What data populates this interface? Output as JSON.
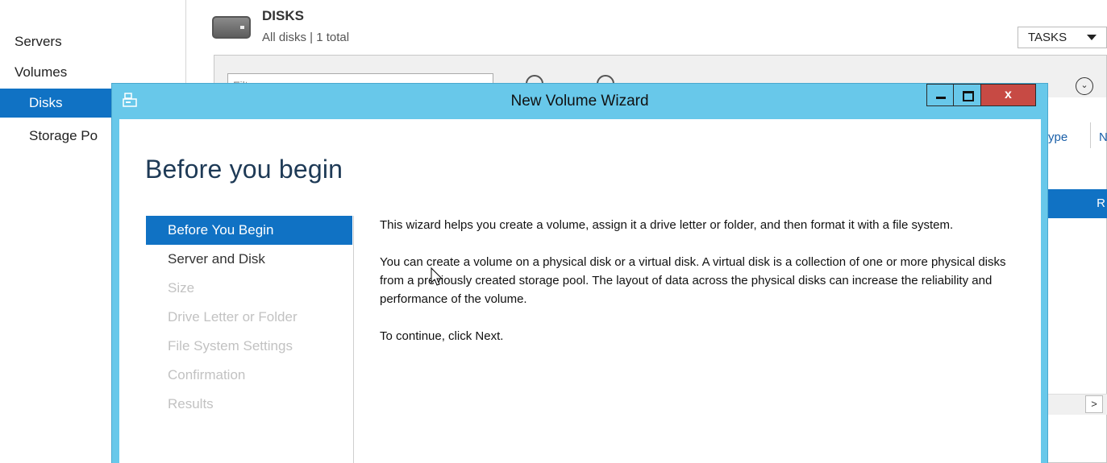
{
  "nav": {
    "items": [
      {
        "label": "Servers"
      },
      {
        "label": "Volumes"
      },
      {
        "label": "Disks"
      },
      {
        "label": "Storage Po"
      }
    ]
  },
  "disks": {
    "title": "DISKS",
    "subtitle": "All disks | 1 total",
    "tasks_label": "TASKS",
    "filter_placeholder": "Filter",
    "col_type": "ype",
    "col_n": "N",
    "selected_row_text": "R",
    "scroll_right": ">",
    "expand_glyph": "⌄"
  },
  "wizard": {
    "title": "New Volume Wizard",
    "close_label": "x",
    "page_title": "Before you begin",
    "steps": [
      {
        "label": "Before You Begin"
      },
      {
        "label": "Server and Disk"
      },
      {
        "label": "Size"
      },
      {
        "label": "Drive Letter or Folder"
      },
      {
        "label": "File System Settings"
      },
      {
        "label": "Confirmation"
      },
      {
        "label": "Results"
      }
    ],
    "paragraphs": [
      "This wizard helps you create a volume, assign it a drive letter or folder, and then format it with a file system.",
      "You can create a volume on a physical disk or a virtual disk. A virtual disk is a collection of one or more physical disks from a previously created storage pool. The layout of data across the physical disks can increase the reliability and performance of the volume.",
      "To continue, click Next."
    ]
  },
  "colors": {
    "accent": "#1072c4",
    "titlebar": "#68c8ea",
    "close": "#c74a44"
  }
}
